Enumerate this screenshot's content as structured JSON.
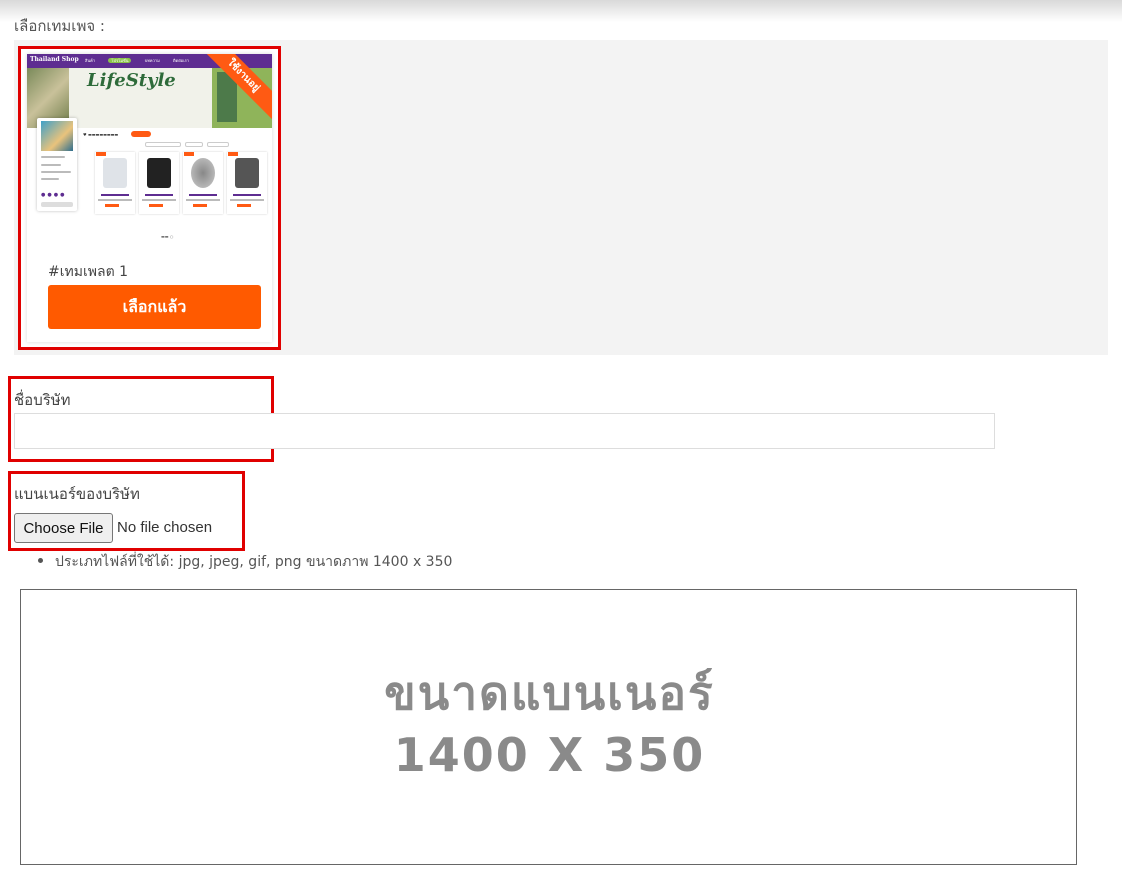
{
  "page": {
    "section_label": "เลือกเทมเพจ :"
  },
  "template": {
    "name": "#เทมเพลต 1",
    "button_label": "เลือกแล้ว",
    "ribbon_label": "ใช้งานอยู่",
    "accent_color": "#ff5a00",
    "preview": {
      "logo_text": "Thailand Shop",
      "hero_title": "LifeStyle",
      "nav_items": [
        "สินค้า",
        "โปรโมชั่น",
        "บทความ",
        "ติดต่อเรา"
      ]
    }
  },
  "company_field": {
    "label": "ชื่อบริษัท",
    "value": "",
    "placeholder": ""
  },
  "banner_field": {
    "label": "แบนเนอร์ของบริษัท",
    "choose_button": "Choose File",
    "status": "No file chosen",
    "hint": "ประเภทไฟล์ที่ใช้ได้: jpg, jpeg, gif, png ขนาดภาพ 1400 x 350"
  },
  "banner_placeholder": {
    "line1": "ขนาดแบนเนอร์",
    "line2": "1400 X 350"
  }
}
